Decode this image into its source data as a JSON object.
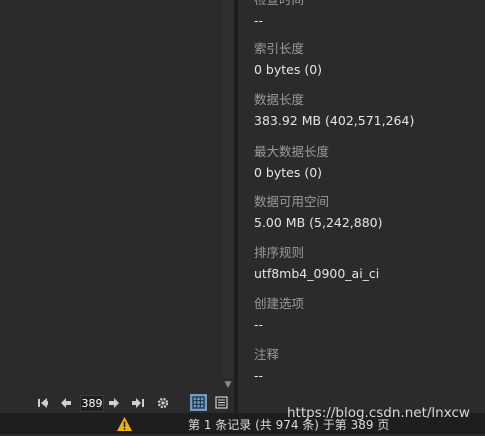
{
  "info_fields": [
    {
      "label": "检查时间",
      "value": "--"
    },
    {
      "label": "索引长度",
      "value": "0 bytes (0)"
    },
    {
      "label": "数据长度",
      "value": "383.92 MB (402,571,264)"
    },
    {
      "label": "最大数据长度",
      "value": "0 bytes (0)"
    },
    {
      "label": "数据可用空间",
      "value": "5.00 MB (5,242,880)"
    },
    {
      "label": "排序规则",
      "value": "utf8mb4_0900_ai_ci"
    },
    {
      "label": "创建选项",
      "value": "--"
    },
    {
      "label": "注释",
      "value": "--"
    }
  ],
  "pagination": {
    "current_page": "389"
  },
  "icons": {
    "first": "first-page-icon",
    "prev": "prev-page-icon",
    "next": "next-page-icon",
    "last": "last-page-icon",
    "settings": "gear-icon",
    "grid": "grid-view-icon",
    "form": "form-view-icon",
    "warning": "warning-icon"
  },
  "colors": {
    "accent": "#6f9cc8",
    "warning": "#f0b400"
  },
  "status": {
    "text": "第 1 条记录 (共 974 条) 于第 389 页"
  },
  "watermark": "https://blog.csdn.net/lnxcw"
}
